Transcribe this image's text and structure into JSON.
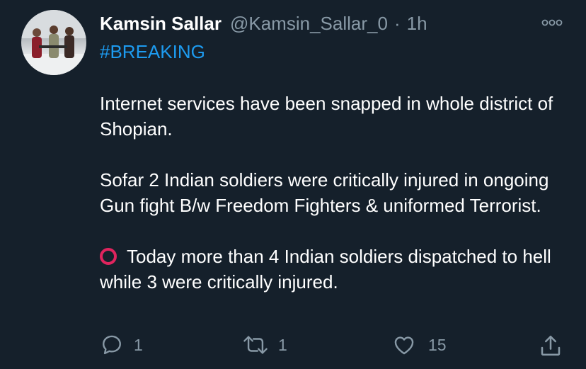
{
  "tweet": {
    "author_name": "Kamsin Sallar",
    "handle": "@Kamsin_Sallar_0",
    "separator": "·",
    "time": "1h",
    "hashtag": "#BREAKING",
    "paragraphs": [
      "Internet services have been snapped in whole district of Shopian.",
      "Sofar 2 Indian soldiers were critically injured in ongoing Gun fight B/w Freedom Fighters & uniformed Terrorist.",
      "Today more than 4 Indian soldiers dispatched to hell while 3 were critically injured."
    ]
  },
  "actions": {
    "reply_count": "1",
    "retweet_count": "1",
    "like_count": "15"
  },
  "icons": {
    "more": "more-icon",
    "reply": "reply-icon",
    "retweet": "retweet-icon",
    "like": "like-icon",
    "share": "share-icon",
    "red_circle": "red-circle-icon"
  },
  "colors": {
    "background": "#15202b",
    "text": "#ffffff",
    "secondary": "#8899a6",
    "link": "#1d9bf0",
    "red": "#e0245e"
  }
}
